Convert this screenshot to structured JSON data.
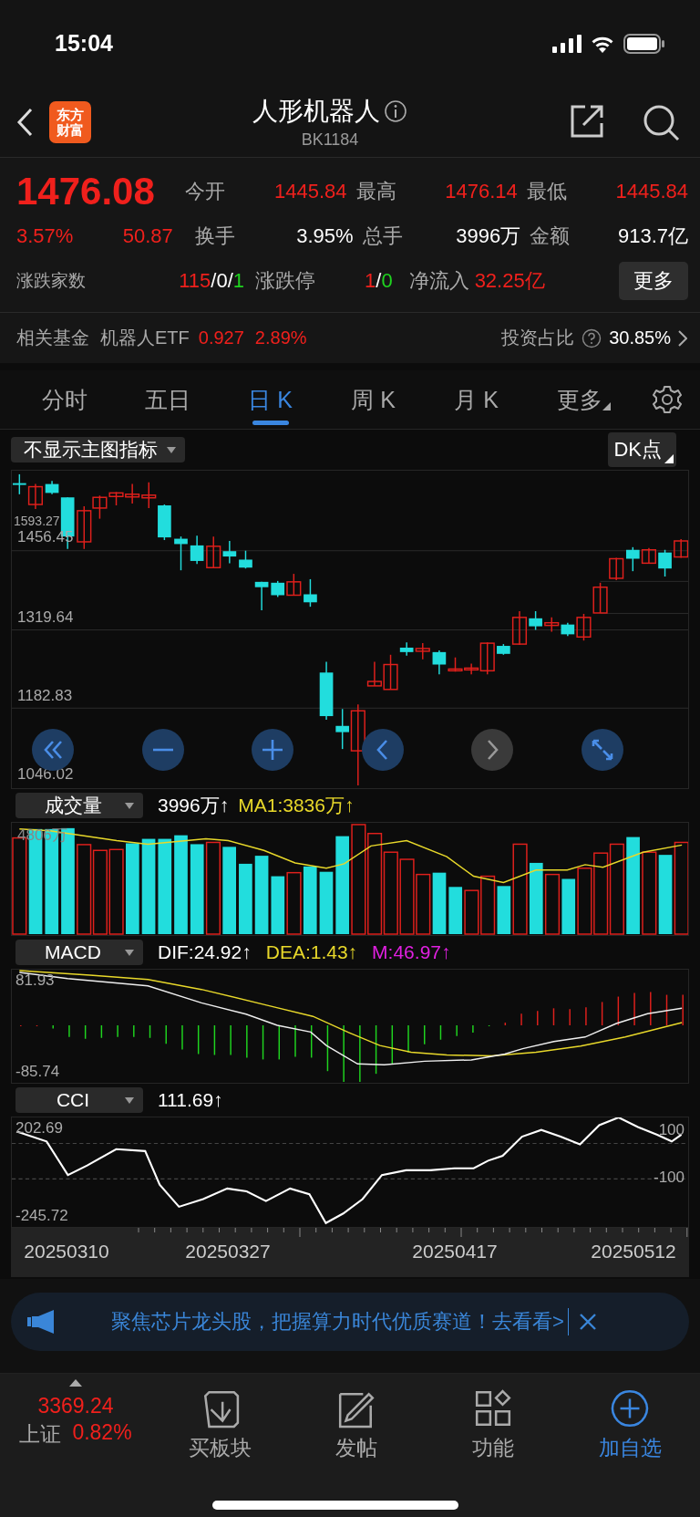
{
  "status_bar": {
    "time": "15:04"
  },
  "header": {
    "logo": [
      "东方",
      "财富"
    ],
    "title": "人形机器人",
    "code": "BK1184"
  },
  "quote": {
    "price": "1476.08",
    "change_pct": "3.57%",
    "change": "50.87",
    "stats": [
      {
        "label": "今开",
        "value": "1445.84",
        "color": "#f0201c"
      },
      {
        "label": "最高",
        "value": "1476.14",
        "color": "#f0201c"
      },
      {
        "label": "最低",
        "value": "1445.84",
        "color": "#f0201c"
      },
      {
        "label": "换手",
        "value": "3.95%",
        "color": "#ffffff"
      },
      {
        "label": "总手",
        "value": "3996万",
        "color": "#ffffff"
      },
      {
        "label": "金额",
        "value": "913.7亿",
        "color": "#ffffff"
      }
    ],
    "breadth": {
      "label": "涨跌家数",
      "parts": [
        {
          "text": "115",
          "color": "#f0201c"
        },
        {
          "text": "/0/",
          "color": "#ffffff"
        },
        {
          "text": "1",
          "color": "#1fd41f"
        }
      ]
    },
    "limit": {
      "label": "涨跌停",
      "parts": [
        {
          "text": "1",
          "color": "#f0201c"
        },
        {
          "text": "/",
          "color": "#ffffff"
        },
        {
          "text": "0",
          "color": "#1fd41f"
        }
      ]
    },
    "net_inflow": {
      "label": "净流入",
      "value": "32.25亿",
      "color": "#f0201c"
    },
    "more_button": "更多"
  },
  "fund": {
    "label": "相关基金",
    "name": "机器人ETF",
    "price": "0.927",
    "change": "2.89%",
    "ratio_label": "投资占比",
    "ratio": "30.85%"
  },
  "tabs": [
    {
      "label": "分时",
      "selected": false
    },
    {
      "label": "五日",
      "selected": false
    },
    {
      "label": "日 K",
      "selected": true
    },
    {
      "label": "周 K",
      "selected": false
    },
    {
      "label": "月 K",
      "selected": false
    },
    {
      "label": "更多",
      "selected": false,
      "dropdown": true
    }
  ],
  "main_chart": {
    "indicator": "不显示主图指标",
    "dk_button": "DK点",
    "y_labels": [
      "1593.27",
      "1456.45",
      "1319.64",
      "1182.83",
      "1046.02"
    ]
  },
  "volume": {
    "selector": "成交量",
    "value": "3996万↑",
    "ma": "MA1:3836万↑",
    "max_label": "4806万"
  },
  "macd": {
    "selector": "MACD",
    "dif": "DIF:24.92↑",
    "dea": "DEA:1.43↑",
    "m": "M:46.97↑",
    "y_labels": [
      "81.93",
      "-85.74"
    ]
  },
  "cci": {
    "selector": "CCI",
    "value": "111.69↑",
    "y_labels": [
      "202.69",
      "-245.72"
    ],
    "ref_labels": [
      "100",
      "-100"
    ]
  },
  "dates": [
    "20250310",
    "20250327",
    "20250417",
    "20250512"
  ],
  "banner": {
    "text": "聚焦芯片龙头股，把握算力时代优质赛道！去看看>"
  },
  "bottom_bar": {
    "index_value": "3369.24",
    "index_name": "上证",
    "index_change": "0.82%",
    "items": [
      {
        "label": "买板块",
        "kind": "buy",
        "highlight": false
      },
      {
        "label": "发帖",
        "kind": "post",
        "highlight": false
      },
      {
        "label": "功能",
        "kind": "apps",
        "highlight": false
      },
      {
        "label": "加自选",
        "kind": "add",
        "highlight": true
      }
    ]
  }
}
